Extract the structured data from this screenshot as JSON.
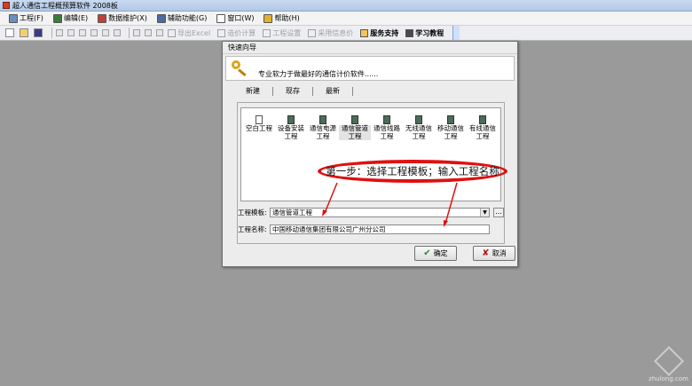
{
  "window": {
    "title": "超人通信工程概预算软件 2008板"
  },
  "menu": [
    {
      "label": "工程(F)",
      "icon": "chart-icon"
    },
    {
      "label": "编辑(E)",
      "icon": "edit-icon"
    },
    {
      "label": "数据维护(X)",
      "icon": "database-icon"
    },
    {
      "label": "辅助功能(G)",
      "icon": "tools-icon"
    },
    {
      "label": "窗口(W)",
      "icon": "window-icon"
    },
    {
      "label": "帮助(H)",
      "icon": "help-icon"
    }
  ],
  "toolbar": {
    "export_excel": "导出Excel",
    "rate_calc": "造价计算",
    "project_settings": "工程设置",
    "material_info": "采用信息价",
    "service_support": "服务支持",
    "tutorial": "学习教程"
  },
  "dialog": {
    "title": "快速向导",
    "banner": "专业软力于做最好的通信计价软件......",
    "tabs": [
      "新建",
      "现存",
      "最新"
    ],
    "templates": [
      {
        "label": "空白工程",
        "icon": "blank-doc-icon"
      },
      {
        "label": "设备安装工程",
        "icon": "equipment-icon"
      },
      {
        "label": "通信电源工程",
        "icon": "power-icon"
      },
      {
        "label": "通信管道工程",
        "icon": "pipeline-icon"
      },
      {
        "label": "通信线路工程",
        "icon": "line-icon"
      },
      {
        "label": "无线通信工程",
        "icon": "wireless-icon"
      },
      {
        "label": "移动通信工程",
        "icon": "mobile-icon"
      },
      {
        "label": "有线通信工程",
        "icon": "wired-icon"
      }
    ],
    "selected_template_index": 3,
    "annotation": "第一步：选择工程模板；输入工程名称",
    "template_field": {
      "label": "工程模板:",
      "value": "通信管道工程"
    },
    "name_field": {
      "label": "工程名称:",
      "value": "中国移动通信集团有限公司广州分公司"
    },
    "browse_label": "...",
    "ok_label": "确定",
    "cancel_label": "取消"
  },
  "watermark": "zhulong.com",
  "colors": {
    "desktop": "#9a9a9a",
    "annotation": "#e01010",
    "titlebar": "#b3c9e6"
  }
}
